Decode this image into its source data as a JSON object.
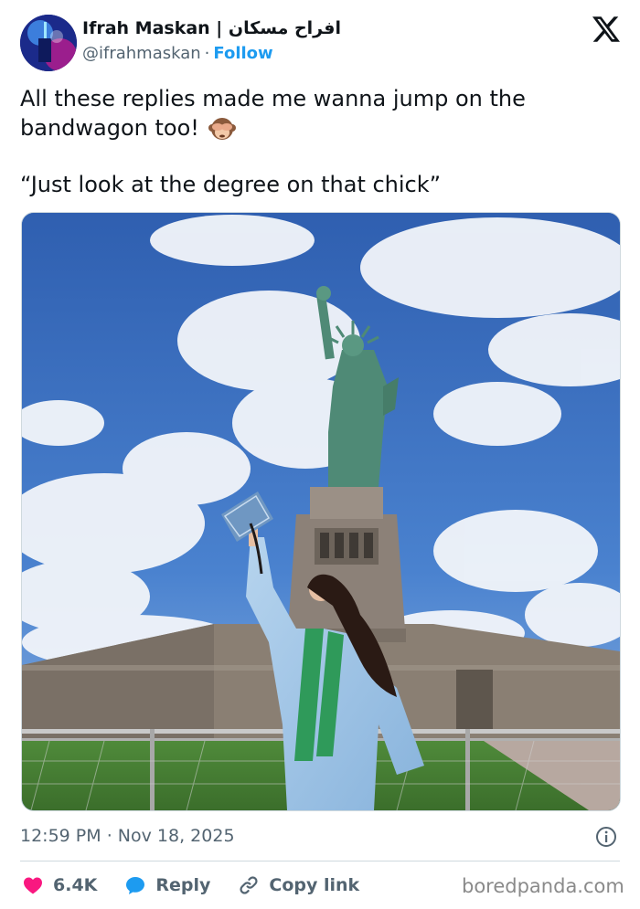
{
  "author": {
    "display_name": "Ifrah Maskan | افراح مسکان",
    "handle": "@ifrahmaskan",
    "separator": "·",
    "follow_label": "Follow"
  },
  "tweet": {
    "line1": "All these replies made me wanna jump on the",
    "line2": "bandwagon too!",
    "emoji_icon": "see-no-evil-monkey-icon",
    "quote": "“Just look at the degree on that chick”"
  },
  "meta": {
    "time": "12:59 PM",
    "separator": "·",
    "date": "Nov 18, 2025"
  },
  "actions": {
    "like_count": "6.4K",
    "reply_label": "Reply",
    "copy_link_label": "Copy link"
  },
  "watermark": "boredpanda.com",
  "colors": {
    "like": "#f91880",
    "link": "#1d9bf0",
    "secondary_text": "#536471",
    "text": "#0f1419"
  }
}
